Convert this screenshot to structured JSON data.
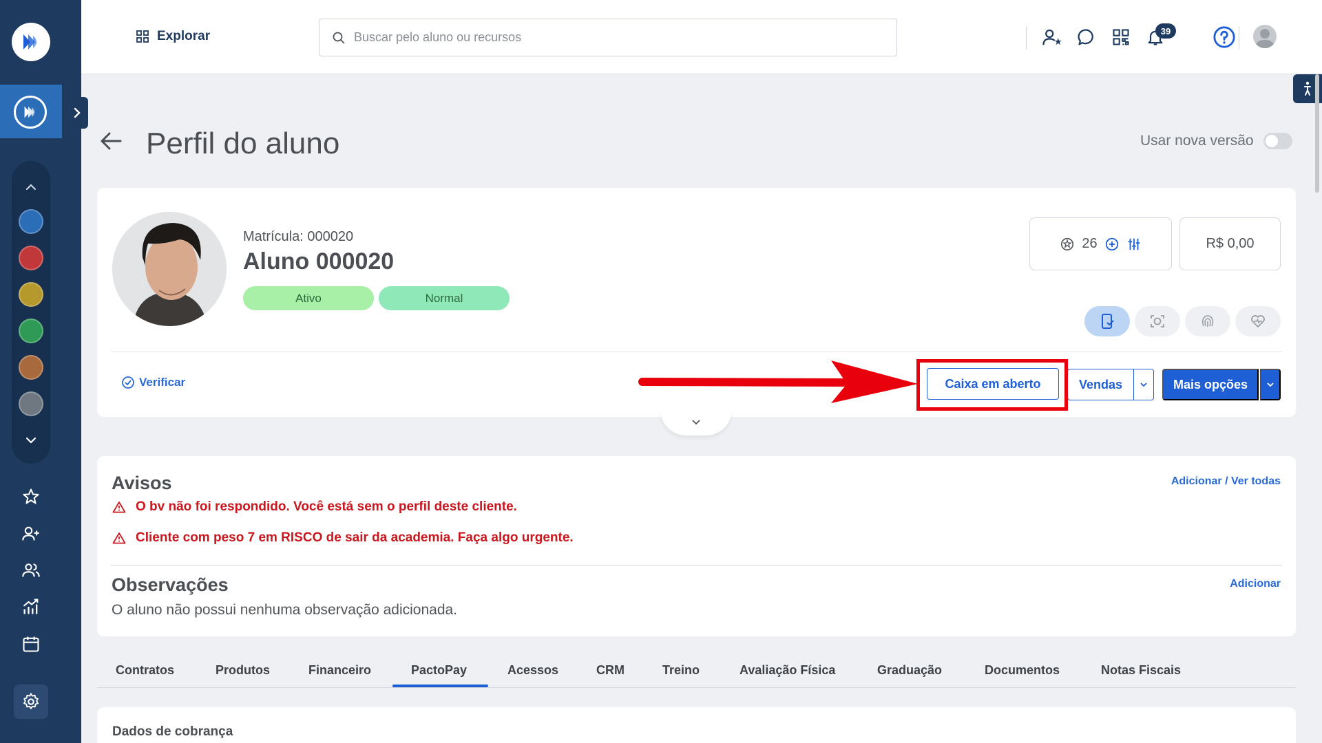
{
  "topbar": {
    "explore_label": "Explorar",
    "search_placeholder": "Buscar pelo aluno ou recursos",
    "notification_count": "39"
  },
  "header": {
    "title": "Perfil do aluno",
    "new_version_label": "Usar nova versão"
  },
  "profile": {
    "matricula": "Matrícula: 000020",
    "name": "Aluno 000020",
    "status_badge": "Ativo",
    "risk_badge": "Normal",
    "points": "26",
    "balance": "R$ 0,00",
    "verify_label": "Verificar"
  },
  "actions": {
    "caixa_label": "Caixa em aberto",
    "vendas_label": "Vendas",
    "mais_label": "Mais opções"
  },
  "avisos": {
    "title": "Avisos",
    "link": "Adicionar / Ver todas",
    "warnings": [
      "O bv não foi respondido. Você está sem o perfil deste cliente.",
      "Cliente com peso 7 em RISCO de sair da academia. Faça algo urgente."
    ]
  },
  "observacoes": {
    "title": "Observações",
    "link": "Adicionar",
    "empty_text": "O aluno não possui nenhuma observação adicionada."
  },
  "tabs": [
    "Contratos",
    "Produtos",
    "Financeiro",
    "PactoPay",
    "Acessos",
    "CRM",
    "Treino",
    "Avaliação Física",
    "Graduação",
    "Documentos",
    "Notas Fiscais"
  ],
  "active_tab": "PactoPay",
  "billing": {
    "title": "Dados de cobrança"
  },
  "colors": {
    "sidebar": "#1e3a5f",
    "primary": "#1f5fd6",
    "warning": "#c8171f",
    "highlight": "#e8000d"
  }
}
